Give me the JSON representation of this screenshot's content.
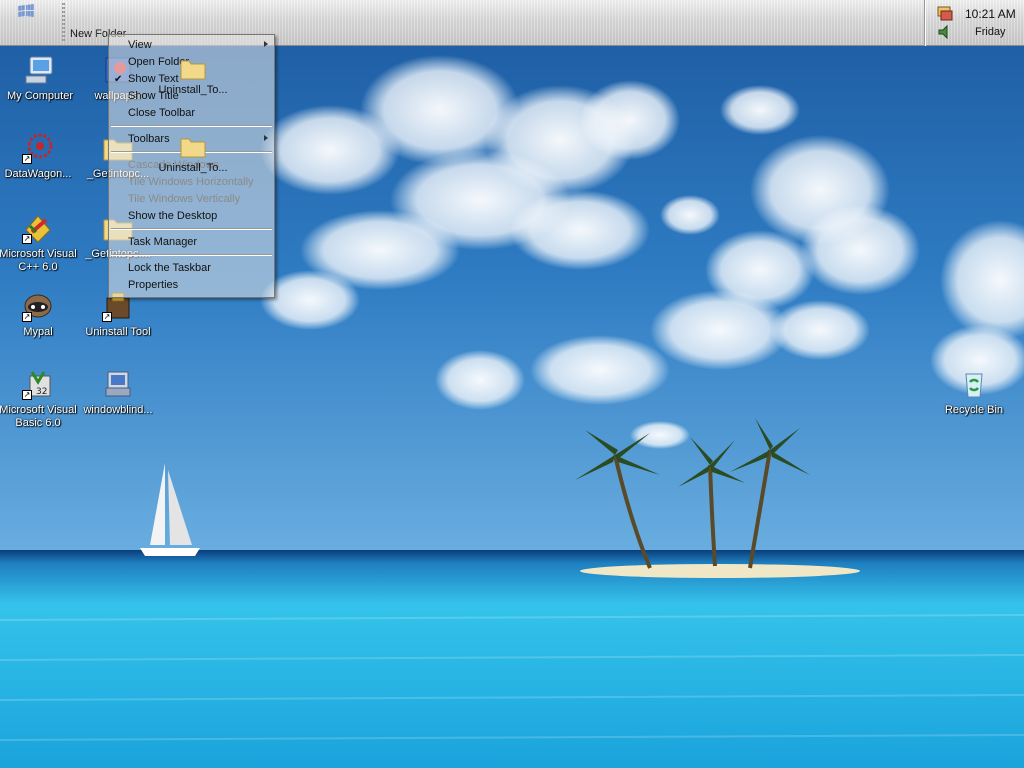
{
  "taskbar": {
    "folder_band_label": "New Folder",
    "clock": "10:21 AM",
    "day": "Friday"
  },
  "band_items": [
    {
      "label": "Uninstall_To..."
    },
    {
      "label": "Uninstall_To..."
    }
  ],
  "context_menu": {
    "items": [
      {
        "label": "View"
      },
      {
        "label": "Open Folder"
      },
      {
        "label": "Show Text"
      },
      {
        "label": "Show Title"
      },
      {
        "label": "Close Toolbar"
      },
      {
        "label": "Toolbars"
      },
      {
        "label": "Cascade Windows"
      },
      {
        "label": "Tile Windows Horizontally"
      },
      {
        "label": "Tile Windows Vertically"
      },
      {
        "label": "Show the Desktop"
      },
      {
        "label": "Task Manager"
      },
      {
        "label": "Lock the Taskbar"
      },
      {
        "label": "Properties"
      }
    ]
  },
  "desktop_icons": [
    {
      "label": "My Computer",
      "icon": "computer-icon"
    },
    {
      "label": "wallpaper",
      "icon": "wallpaper-icon"
    },
    {
      "label": "DataWagon...",
      "icon": "datawagon-icon"
    },
    {
      "label": "_Getintopc...",
      "icon": "folder-icon"
    },
    {
      "label": "Microsoft Visual",
      "label2": "C++ 6.0",
      "icon": "visual-cpp-icon"
    },
    {
      "label": "_Getintopc....",
      "icon": "folder-icon"
    },
    {
      "label": "Mypal",
      "icon": "mypal-icon"
    },
    {
      "label": "Uninstall Tool",
      "icon": "uninstall-tool-icon"
    },
    {
      "label": "Microsoft Visual",
      "label2": "Basic 6.0",
      "icon": "visual-basic-icon"
    },
    {
      "label": "windowblind...",
      "icon": "windowblinds-icon"
    },
    {
      "label": "Recycle Bin",
      "icon": "recycle-bin-icon"
    }
  ],
  "colors": {
    "sky_top": "#1a5fa8",
    "sea": "#2fb8e6",
    "taskbar": "#d6d6d6"
  }
}
